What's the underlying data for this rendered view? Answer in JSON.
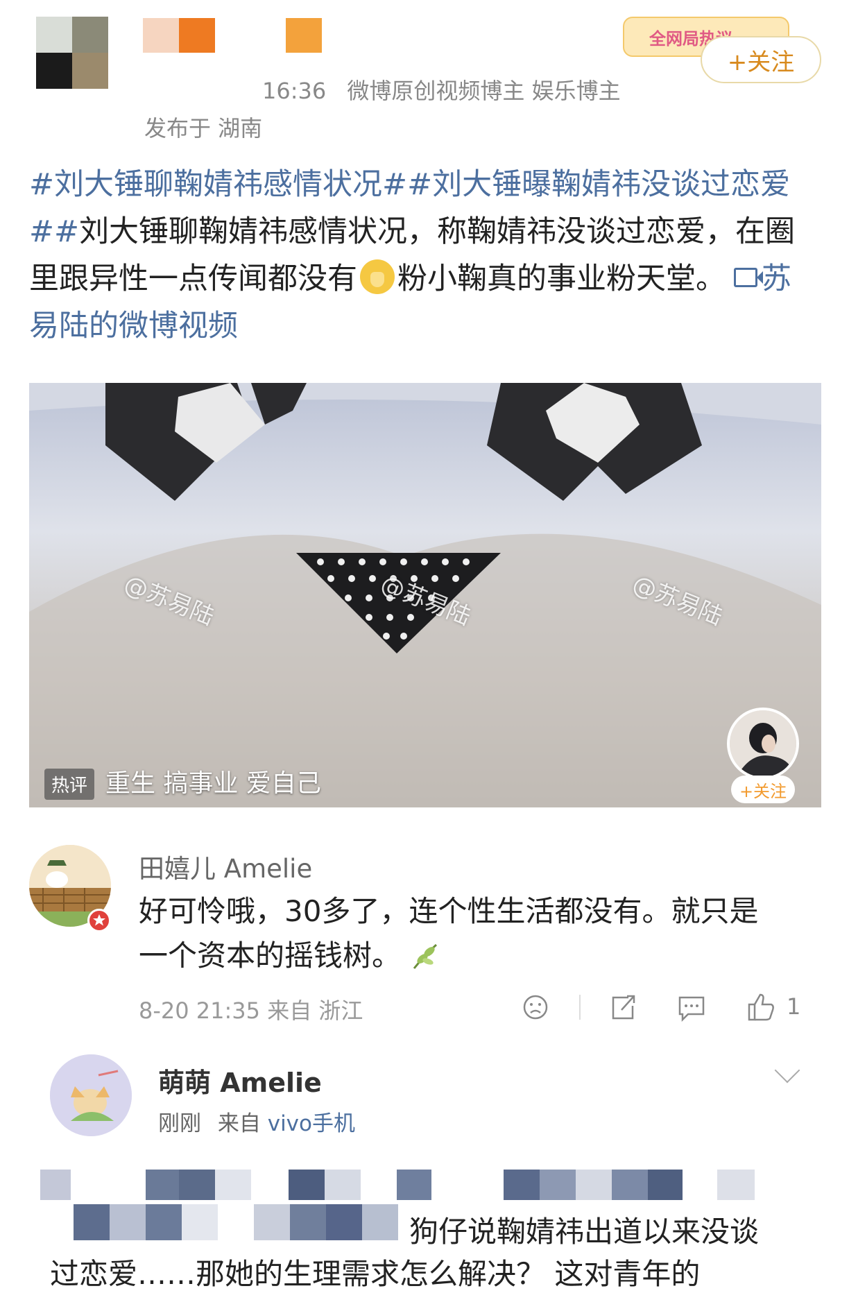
{
  "header": {
    "time": "16:36",
    "badges": "微博原创视频博主 娱乐博主",
    "location": "发布于 湖南",
    "follow_label": "+关注",
    "event_badge": "全网局热议"
  },
  "post": {
    "hashtag1": "#刘大锤聊鞠婧祎感情状况#",
    "hashtag2": "#刘大锤曝鞠婧祎没谈过恋爱#",
    "text_a": "刘大锤聊鞠婧祎感情状况，称鞠婧祎没谈过恋爱，在圈里跟异性一点传闻都没有",
    "text_b": "粉小鞠真的事业粉天堂。",
    "video_link": "苏易陆的微博视频"
  },
  "video": {
    "watermark": "@苏易陆",
    "hot_tag": "热评",
    "hot_text": "重生 搞事业 爱自己",
    "creator_follow": "+关注"
  },
  "comment1": {
    "author": "田嬉儿 Amelie",
    "text_line1": "好可怜哦，30多了，连个性生活都没有。就只是",
    "text_line2": "一个资本的摇钱树。",
    "meta": "8-20 21:35 来自 浙江",
    "like_count": "1"
  },
  "comment2": {
    "author": "萌萌 Amelie",
    "time": "刚刚",
    "source_prefix": "来自",
    "device": "vivo手机"
  },
  "bottom": {
    "line1": "狗仔说鞠婧祎出道以来没谈",
    "line2": "过恋爱……那她的生理需求怎么解决？    这对青年的"
  },
  "colors": {
    "link": "#4c6f9f",
    "accent_orange": "#d88a1e"
  }
}
